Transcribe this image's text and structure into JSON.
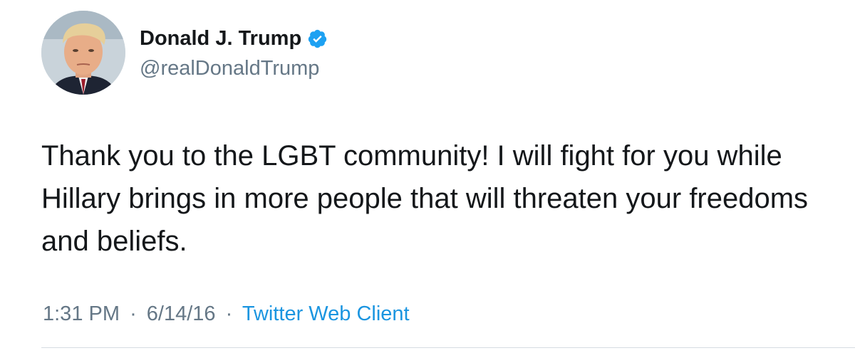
{
  "tweet": {
    "author": {
      "display_name": "Donald J. Trump",
      "handle": "@realDonaldTrump",
      "verified": true
    },
    "text": "Thank you to the LGBT community! I will fight for you while\nHillary brings in more people that will threaten your freedoms\nand beliefs.",
    "meta": {
      "time": "1:31 PM",
      "separator": "·",
      "date": "6/14/16",
      "source": "Twitter Web Client"
    }
  },
  "colors": {
    "text": "#14171a",
    "secondary": "#657786",
    "link": "#1b95e0",
    "verified": "#1da1f2"
  },
  "icons": {
    "verified": "verified-badge-icon",
    "avatar": "profile-photo"
  }
}
